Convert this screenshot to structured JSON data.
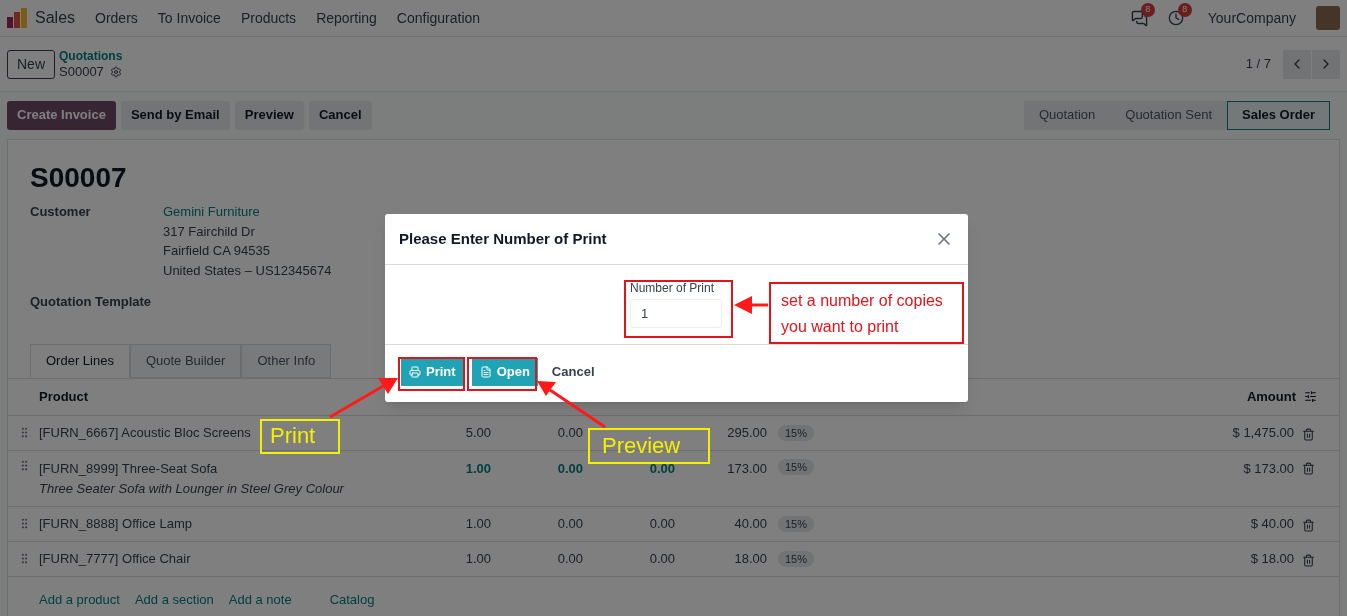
{
  "navbar": {
    "app_name": "Sales",
    "menu": [
      "Orders",
      "To Invoice",
      "Products",
      "Reporting",
      "Configuration"
    ],
    "messages_badge": "8",
    "activities_badge": "8",
    "company": "YourCompany"
  },
  "control_panel": {
    "new_button": "New",
    "breadcrumb_parent": "Quotations",
    "breadcrumb_current": "S00007",
    "pager": "1 / 7"
  },
  "actions": [
    {
      "label": "Create Invoice",
      "kind": "primary"
    },
    {
      "label": "Send by Email",
      "kind": "secondary"
    },
    {
      "label": "Preview",
      "kind": "secondary"
    },
    {
      "label": "Cancel",
      "kind": "secondary"
    }
  ],
  "statusbar": [
    {
      "label": "Quotation",
      "selected": false
    },
    {
      "label": "Quotation Sent",
      "selected": false
    },
    {
      "label": "Sales Order",
      "selected": true
    }
  ],
  "form": {
    "title": "S00007",
    "customer_label": "Customer",
    "customer_name": "Gemini Furniture",
    "address_lines": [
      "317 Fairchild Dr",
      "Fairfield CA 94535",
      "United States – US12345674"
    ],
    "template_label": "Quotation Template"
  },
  "tabs": [
    {
      "label": "Order Lines",
      "selected": true
    },
    {
      "label": "Quote Builder",
      "selected": false
    },
    {
      "label": "Other Info",
      "selected": false
    }
  ],
  "table": {
    "columns": [
      "Product",
      "Amount"
    ],
    "rows": [
      {
        "product": "[FURN_6667] Acoustic Bloc Screens",
        "column_2": "5.00",
        "column_3": "0.00",
        "column_5": "295.00",
        "tax": "15%",
        "amount": "$ 1,475.00",
        "highlighted": false
      },
      {
        "product": "[FURN_8999] Three-Seat Sofa",
        "description": "Three Seater Sofa with Lounger in Steel Grey Colour",
        "column_2": "1.00",
        "column_3": "0.00",
        "column_4": "0.00",
        "column_5": "173.00",
        "tax": "15%",
        "amount": "$ 173.00",
        "highlighted": true
      },
      {
        "product": "[FURN_8888] Office Lamp",
        "column_2": "1.00",
        "column_3": "0.00",
        "column_4": "0.00",
        "column_5": "40.00",
        "tax": "15%",
        "amount": "$ 40.00",
        "highlighted": false
      },
      {
        "product": "[FURN_7777] Office Chair",
        "column_2": "1.00",
        "column_3": "0.00",
        "column_4": "0.00",
        "column_5": "18.00",
        "tax": "15%",
        "amount": "$ 18.00",
        "highlighted": false
      }
    ],
    "links": [
      "Add a product",
      "Add a section",
      "Add a note",
      "Catalog"
    ]
  },
  "dialog": {
    "title": "Please Enter Number of Print",
    "field_label": "Number of Print",
    "field_value": "1",
    "buttons": [
      {
        "label": "Print",
        "kind": "print"
      },
      {
        "label": "Open",
        "kind": "open"
      },
      {
        "label": "Cancel",
        "kind": "cancel"
      }
    ]
  },
  "annotations": {
    "callout": "set a number of copies you want to print",
    "labels": [
      "Print",
      "Preview"
    ]
  }
}
